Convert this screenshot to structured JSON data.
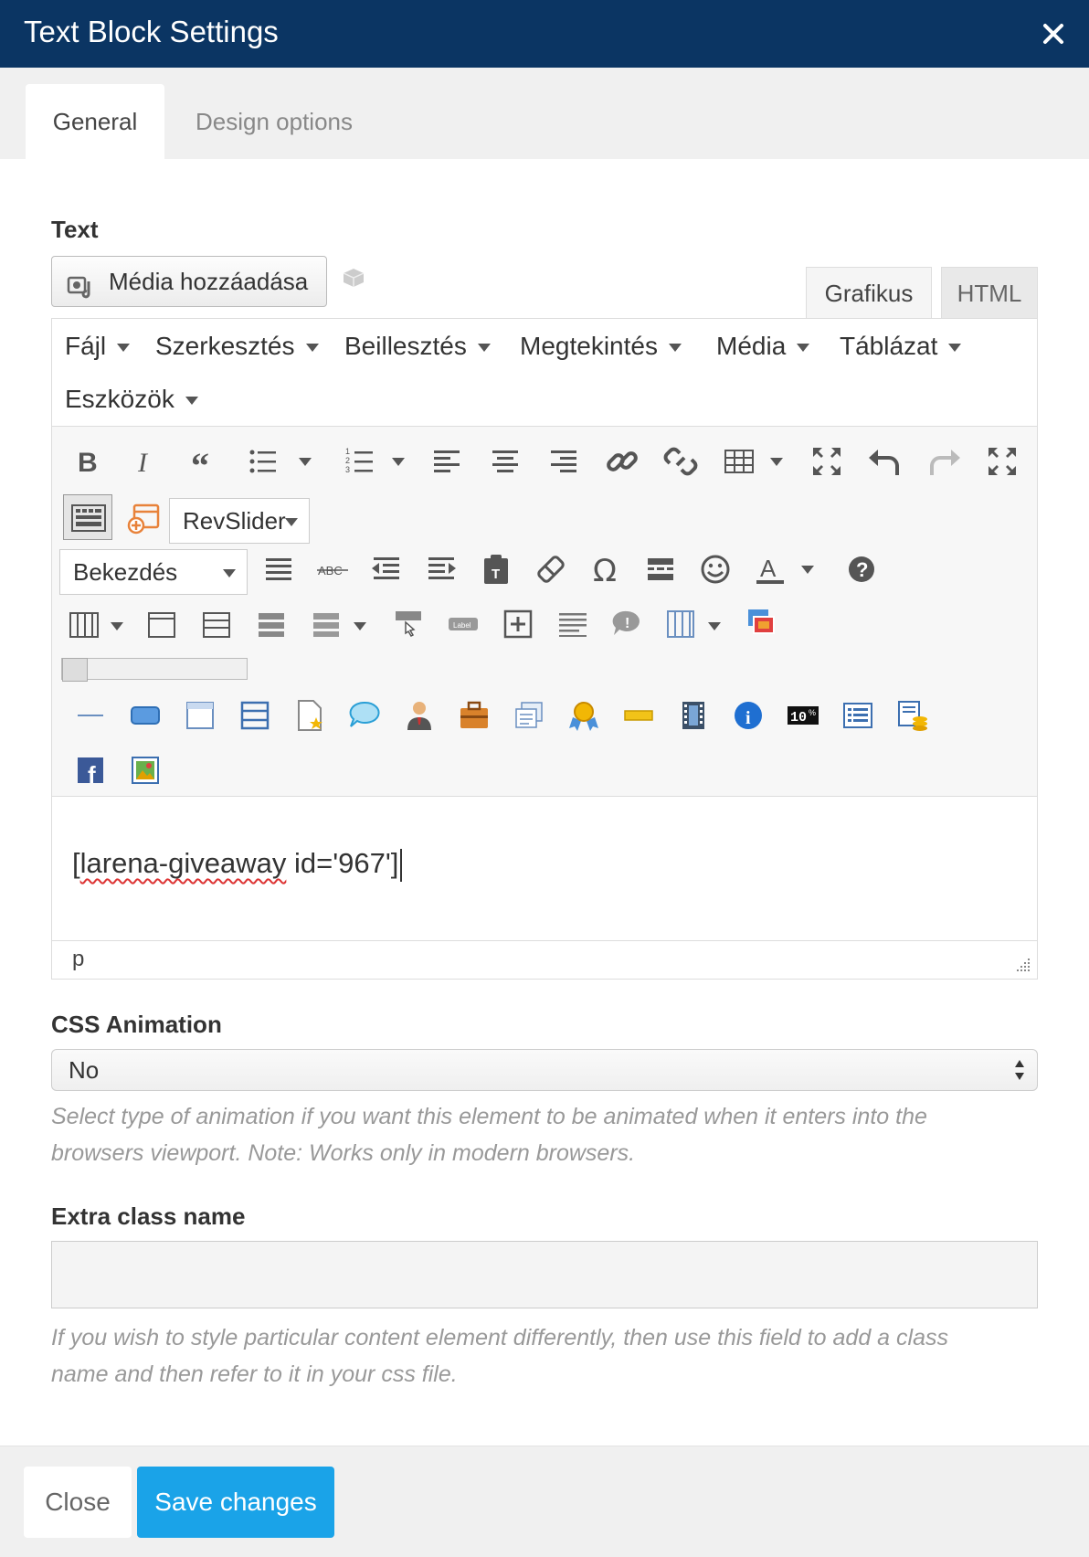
{
  "dialog": {
    "title": "Text Block Settings"
  },
  "tabs": [
    {
      "label": "General"
    },
    {
      "label": "Design options"
    }
  ],
  "text_field": {
    "label": "Text",
    "media_button_label": "Média hozzáadása",
    "mode_tabs": {
      "visual": "Grafikus",
      "html": "HTML"
    },
    "menubar": [
      "Fájl",
      "Szerkesztés",
      "Beillesztés",
      "Megtekintés",
      "Média",
      "Táblázat",
      "Eszközök"
    ],
    "revslider_label": "RevSlider",
    "format_select_value": "Bekezdés",
    "content_prefix": "[",
    "content_misspelled": "larena-giveaway",
    "content_suffix": " id='967']",
    "status_path": "p"
  },
  "css_animation": {
    "label": "CSS Animation",
    "value": "No",
    "help": "Select type of animation if you want this element to be animated when it enters into the browsers viewport. Note: Works only in modern browsers."
  },
  "extra_class": {
    "label": "Extra class name",
    "value": "",
    "help": "If you wish to style particular content element differently, then use this field to add a class name and then refer to it in your css file."
  },
  "footer": {
    "close_label": "Close",
    "save_label": "Save changes"
  },
  "colors": {
    "header_bg": "#0b3563",
    "primary": "#1aa3e8"
  }
}
